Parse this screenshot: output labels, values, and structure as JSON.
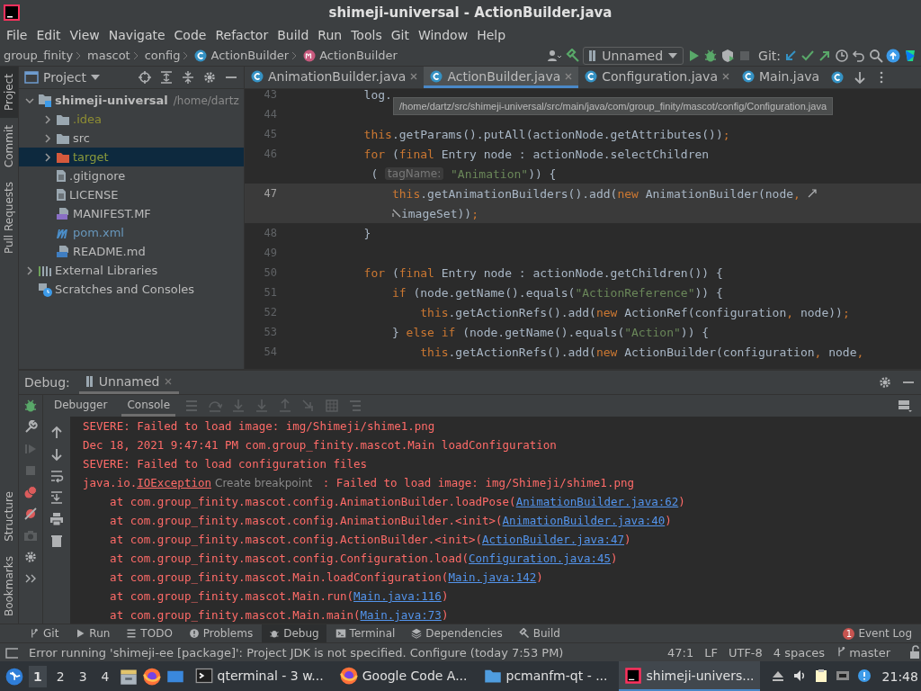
{
  "window": {
    "title": "shimeji-universal - ActionBuilder.java"
  },
  "menu": [
    "File",
    "Edit",
    "View",
    "Navigate",
    "Code",
    "Refactor",
    "Build",
    "Run",
    "Tools",
    "Git",
    "Window",
    "Help"
  ],
  "breadcrumbs": [
    {
      "label": "group_finity",
      "kind": "package"
    },
    {
      "label": "mascot",
      "kind": "package"
    },
    {
      "label": "config",
      "kind": "package"
    },
    {
      "label": "ActionBuilder",
      "kind": "class"
    },
    {
      "label": "ActionBuilder",
      "kind": "method"
    }
  ],
  "run_config": {
    "label": "Unnamed"
  },
  "git_label": "Git:",
  "left_tool_tabs": [
    {
      "label": "Project",
      "selected": true
    },
    {
      "label": "Commit",
      "selected": false
    },
    {
      "label": "Pull Requests",
      "selected": false
    }
  ],
  "left_tool_tabs_bottom": [
    {
      "label": "Structure",
      "selected": false
    },
    {
      "label": "Bookmarks",
      "selected": false
    }
  ],
  "project_panel": {
    "title": "Project",
    "tree": [
      {
        "label": "shimeji-universal",
        "path": "/home/dartz",
        "kind": "module",
        "color": "#bbbbbb",
        "expanded": true,
        "selected": false,
        "children": [
          {
            "label": ".idea",
            "kind": "folder",
            "color": "#8f8e33",
            "excluded": false,
            "expanded": false,
            "selected": false
          },
          {
            "label": "src",
            "kind": "folder",
            "color": "#bbbbbb",
            "excluded": false,
            "expanded": false,
            "selected": false
          },
          {
            "label": "target",
            "kind": "folder",
            "color": "#8b9a3b",
            "excluded": true,
            "expanded": false,
            "selected": true
          },
          {
            "label": ".gitignore",
            "kind": "file",
            "color": "#bbbbbb",
            "excluded": false,
            "selected": false
          },
          {
            "label": "LICENSE",
            "kind": "file",
            "color": "#bbbbbb",
            "excluded": false,
            "selected": false
          },
          {
            "label": "MANIFEST.MF",
            "kind": "manifest",
            "color": "#bbbbbb",
            "excluded": false,
            "selected": false
          },
          {
            "label": "pom.xml",
            "kind": "maven",
            "color": "#6897bb",
            "excluded": false,
            "selected": false
          },
          {
            "label": "README.md",
            "kind": "markdown",
            "color": "#bbbbbb",
            "excluded": false,
            "selected": false
          }
        ]
      },
      {
        "label": "External Libraries",
        "kind": "libraries",
        "color": "#bbbbbb",
        "expanded": false,
        "selected": false
      },
      {
        "label": "Scratches and Consoles",
        "kind": "scratches",
        "color": "#bbbbbb",
        "selected": false
      }
    ]
  },
  "editor_tabs": [
    {
      "label": "AnimationBuilder.java",
      "selected": false,
      "closable": true
    },
    {
      "label": "ActionBuilder.java",
      "selected": true,
      "closable": true
    },
    {
      "label": "Configuration.java",
      "selected": false,
      "closable": true
    },
    {
      "label": "Main.java",
      "selected": false,
      "closable": false
    }
  ],
  "tooltip": "/home/dartz/src/shimeji-universal/src/main/java/com/group_finity/mascot/config/Configuration.java",
  "code_lines": [
    {
      "number": "43",
      "current": false,
      "segments": [
        {
          "kind": "plain",
          "text": "        log."
        }
      ]
    },
    {
      "number": "44",
      "current": false
    },
    {
      "number": "45",
      "current": false,
      "segments": [
        {
          "kind": "kw",
          "text": "        this"
        },
        {
          "kind": "plain",
          "text": ".getParams().putAll(actionNode.getAttributes())"
        },
        {
          "kind": "kw",
          "text": ";"
        }
      ]
    },
    {
      "number": "46",
      "current": false,
      "segments": [
        {
          "kind": "kw",
          "text": "        for "
        },
        {
          "kind": "plain",
          "text": "("
        },
        {
          "kind": "kw",
          "text": "final "
        },
        {
          "kind": "plain",
          "text": "Entry node : actionNode.selectChildren"
        }
      ]
    },
    {
      "current": false,
      "segments": [
        {
          "kind": "plain",
          "text": "         ( "
        },
        {
          "kind": "hint",
          "text": "tagName:"
        },
        {
          "kind": "str",
          "text": " \"Animation\""
        },
        {
          "kind": "plain",
          "text": ")) {"
        }
      ]
    },
    {
      "number": "47",
      "current": true,
      "segments": [
        {
          "kind": "kw",
          "text": "            this"
        },
        {
          "kind": "plain",
          "text": ".getAnimationBuilders().add("
        },
        {
          "kind": "kw",
          "text": "new "
        },
        {
          "kind": "plain",
          "text": "AnimationBuilder(node"
        },
        {
          "kind": "kw",
          "text": ", "
        },
        {
          "kind": "wrap-end"
        }
      ]
    },
    {
      "current": true,
      "segments": [
        {
          "kind": "wrap-start"
        },
        {
          "kind": "plain",
          "text": "imageSet))"
        },
        {
          "kind": "kw",
          "text": ";"
        }
      ]
    },
    {
      "number": "48",
      "current": false,
      "segments": [
        {
          "kind": "plain",
          "text": "        }"
        }
      ]
    },
    {
      "number": "49",
      "current": false
    },
    {
      "number": "50",
      "current": false,
      "segments": [
        {
          "kind": "kw",
          "text": "        for "
        },
        {
          "kind": "plain",
          "text": "("
        },
        {
          "kind": "kw",
          "text": "final "
        },
        {
          "kind": "plain",
          "text": "Entry node : actionNode.getChildren()) {"
        }
      ]
    },
    {
      "number": "51",
      "current": false,
      "segments": [
        {
          "kind": "kw",
          "text": "            if "
        },
        {
          "kind": "plain",
          "text": "(node.getName().equals("
        },
        {
          "kind": "str",
          "text": "\"ActionReference\""
        },
        {
          "kind": "plain",
          "text": ")) {"
        }
      ]
    },
    {
      "number": "52",
      "current": false,
      "segments": [
        {
          "kind": "kw",
          "text": "                this"
        },
        {
          "kind": "plain",
          "text": ".getActionRefs().add("
        },
        {
          "kind": "kw",
          "text": "new "
        },
        {
          "kind": "plain",
          "text": "ActionRef(configuration"
        },
        {
          "kind": "kw",
          "text": ", "
        },
        {
          "kind": "plain",
          "text": "node))"
        },
        {
          "kind": "kw",
          "text": ";"
        }
      ]
    },
    {
      "number": "53",
      "current": false,
      "segments": [
        {
          "kind": "plain",
          "text": "            } "
        },
        {
          "kind": "kw",
          "text": "else if "
        },
        {
          "kind": "plain",
          "text": "(node.getName().equals("
        },
        {
          "kind": "str",
          "text": "\"Action\""
        },
        {
          "kind": "plain",
          "text": ")) {"
        }
      ]
    },
    {
      "number": "54",
      "current": false,
      "segments": [
        {
          "kind": "kw",
          "text": "                this"
        },
        {
          "kind": "plain",
          "text": ".getActionRefs().add("
        },
        {
          "kind": "kw",
          "text": "new "
        },
        {
          "kind": "plain",
          "text": "ActionBuilder(configuration"
        },
        {
          "kind": "kw",
          "text": ", "
        },
        {
          "kind": "plain",
          "text": "node"
        },
        {
          "kind": "kw",
          "text": ","
        }
      ]
    }
  ],
  "debug": {
    "title": "Debug:",
    "session": "Unnamed",
    "tabs": [
      {
        "label": "Debugger",
        "selected": false
      },
      {
        "label": "Console",
        "selected": true
      }
    ],
    "console_lines": [
      [
        {
          "kind": "err",
          "text": "SEVERE: Failed to load image: img/Shimeji/shime1.png"
        }
      ],
      [
        {
          "kind": "err",
          "text": "Dec 18, 2021 9:47:41 PM com.group_finity.mascot.Main loadConfiguration"
        }
      ],
      [
        {
          "kind": "err",
          "text": "SEVERE: Failed to load configuration files"
        }
      ],
      [
        {
          "kind": "err",
          "text": "java.io."
        },
        {
          "kind": "err-underline",
          "text": "IOException"
        },
        {
          "kind": "hint",
          "text": "Create breakpoint"
        },
        {
          "kind": "err",
          "text": " : Failed to load image: img/Shimeji/shime1.png"
        }
      ],
      [
        {
          "kind": "err",
          "text": "    at com.group_finity.mascot.config.AnimationBuilder.loadPose("
        },
        {
          "kind": "link",
          "text": "AnimationBuilder.java:62"
        },
        {
          "kind": "err",
          "text": ")"
        }
      ],
      [
        {
          "kind": "err",
          "text": "    at com.group_finity.mascot.config.AnimationBuilder.<init>("
        },
        {
          "kind": "link",
          "text": "AnimationBuilder.java:40"
        },
        {
          "kind": "err",
          "text": ")"
        }
      ],
      [
        {
          "kind": "err",
          "text": "    at com.group_finity.mascot.config.ActionBuilder.<init>("
        },
        {
          "kind": "link",
          "text": "ActionBuilder.java:47"
        },
        {
          "kind": "err",
          "text": ")"
        }
      ],
      [
        {
          "kind": "err",
          "text": "    at com.group_finity.mascot.config.Configuration.load("
        },
        {
          "kind": "link",
          "text": "Configuration.java:45"
        },
        {
          "kind": "err",
          "text": ")"
        }
      ],
      [
        {
          "kind": "err",
          "text": "    at com.group_finity.mascot.Main.loadConfiguration("
        },
        {
          "kind": "link",
          "text": "Main.java:142"
        },
        {
          "kind": "err",
          "text": ")"
        }
      ],
      [
        {
          "kind": "err",
          "text": "    at com.group_finity.mascot.Main.run("
        },
        {
          "kind": "link",
          "text": "Main.java:116"
        },
        {
          "kind": "err",
          "text": ")"
        }
      ],
      [
        {
          "kind": "err",
          "text": "    at com.group_finity.mascot.Main.main("
        },
        {
          "kind": "link",
          "text": "Main.java:73"
        },
        {
          "kind": "err",
          "text": ")"
        }
      ]
    ]
  },
  "tool_windows": [
    {
      "label": "Git",
      "kind": "git",
      "selected": false
    },
    {
      "label": "Run",
      "kind": "run",
      "selected": false
    },
    {
      "label": "TODO",
      "kind": "todo",
      "selected": false
    },
    {
      "label": "Problems",
      "kind": "problems",
      "selected": false
    },
    {
      "label": "Debug",
      "kind": "debug",
      "selected": true
    },
    {
      "label": "Terminal",
      "kind": "terminal",
      "selected": false
    },
    {
      "label": "Dependencies",
      "kind": "dependencies",
      "selected": false
    },
    {
      "label": "Build",
      "kind": "build",
      "selected": false
    }
  ],
  "event_log": {
    "label": "Event Log",
    "count": "1"
  },
  "status_bar": {
    "message": "Error running 'shimeji-ee [package]': Project JDK is not specified. Configure (today 7:53 PM)",
    "items": [
      "47:1",
      "LF",
      "UTF-8",
      "4 spaces"
    ],
    "branch": "master"
  },
  "taskbar": {
    "workspaces": [
      {
        "label": "1",
        "selected": true
      },
      {
        "label": "2",
        "selected": false
      },
      {
        "label": "3",
        "selected": false
      },
      {
        "label": "4",
        "selected": false
      }
    ],
    "windows": [
      {
        "label": "qterminal - 3 w...",
        "kind": "terminal",
        "selected": false
      },
      {
        "label": "Google Code A...",
        "kind": "browser",
        "selected": false
      },
      {
        "label": "pcmanfm-qt - ...",
        "kind": "files",
        "selected": false
      },
      {
        "label": "shimeji-univers...",
        "kind": "ide",
        "selected": true
      }
    ],
    "clock": "21:48"
  }
}
